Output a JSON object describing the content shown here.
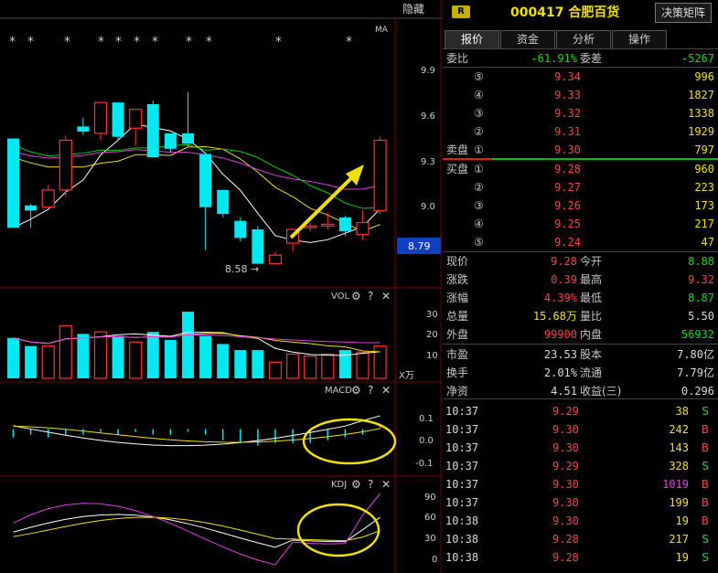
{
  "topbar": {
    "hide_label": "隐藏",
    "ma_label": "MA"
  },
  "price_axis": [
    "9.9",
    "9.6",
    "9.3",
    "9.0",
    "8.79"
  ],
  "low_marker": "8.58",
  "vol_panel": {
    "label": "VOL",
    "axis": [
      "30",
      "20",
      "10"
    ],
    "unit": "X万"
  },
  "macd_panel": {
    "label": "MACD",
    "axis": [
      "0.1",
      "0.0",
      "-0.1"
    ]
  },
  "kdj_panel": {
    "label": "KDJ",
    "axis": [
      "90",
      "60",
      "30",
      "0"
    ]
  },
  "icons": {
    "gear": "gear-icon",
    "help": "help-icon",
    "close": "close-icon"
  },
  "colors": {
    "up": "#ff3030",
    "down": "#00e8f0",
    "ma5": "#ffffff",
    "ma10": "#f0e000",
    "ma20": "#e040e0",
    "ma60": "#00d000",
    "highlight": "#f0e000"
  },
  "chart_data": {
    "type": "candlestick",
    "candles": [
      {
        "o": 9.31,
        "c": 8.79,
        "h": 9.31,
        "l": 8.79
      },
      {
        "o": 8.92,
        "c": 8.89,
        "h": 8.93,
        "l": 8.79
      },
      {
        "o": 8.91,
        "c": 9.01,
        "h": 9.04,
        "l": 8.91
      },
      {
        "o": 9.01,
        "c": 9.3,
        "h": 9.33,
        "l": 8.97
      },
      {
        "o": 9.38,
        "c": 9.35,
        "h": 9.43,
        "l": 9.33
      },
      {
        "o": 9.34,
        "c": 9.52,
        "h": 9.52,
        "l": 9.3
      },
      {
        "o": 9.52,
        "c": 9.32,
        "h": 9.52,
        "l": 9.3
      },
      {
        "o": 9.37,
        "c": 9.48,
        "h": 9.48,
        "l": 9.27
      },
      {
        "o": 9.51,
        "c": 9.2,
        "h": 9.53,
        "l": 9.2
      },
      {
        "o": 9.34,
        "c": 9.25,
        "h": 9.34,
        "l": 9.23
      },
      {
        "o": 9.34,
        "c": 9.28,
        "h": 9.58,
        "l": 9.26
      },
      {
        "o": 9.22,
        "c": 8.91,
        "h": 9.22,
        "l": 8.66
      },
      {
        "o": 9.01,
        "c": 8.87,
        "h": 9.01,
        "l": 8.85
      },
      {
        "o": 8.83,
        "c": 8.73,
        "h": 8.85,
        "l": 8.71
      },
      {
        "o": 8.78,
        "c": 8.58,
        "h": 8.8,
        "l": 8.58
      },
      {
        "o": 8.58,
        "c": 8.63,
        "h": 8.65,
        "l": 8.58
      },
      {
        "o": 8.7,
        "c": 8.78,
        "h": 8.78,
        "l": 8.65
      },
      {
        "o": 8.79,
        "c": 8.8,
        "h": 8.82,
        "l": 8.77
      },
      {
        "o": 8.8,
        "c": 8.81,
        "h": 8.88,
        "l": 8.78
      },
      {
        "o": 8.85,
        "c": 8.77,
        "h": 8.86,
        "l": 8.74
      },
      {
        "o": 8.75,
        "c": 8.82,
        "h": 8.89,
        "l": 8.72
      },
      {
        "o": 8.89,
        "c": 9.3,
        "h": 9.32,
        "l": 8.87
      }
    ],
    "volume": [
      20,
      16,
      16,
      26,
      22,
      23,
      21,
      18,
      23,
      19,
      33,
      21,
      17,
      14,
      14,
      8,
      12,
      11,
      12,
      14,
      13,
      16
    ],
    "macd_hist": [
      -0.03,
      -0.02,
      -0.03,
      -0.02,
      -0.02,
      -0.01,
      -0.02,
      -0.01,
      -0.02,
      -0.02,
      -0.01,
      -0.02,
      -0.04,
      -0.05,
      -0.06,
      -0.05,
      -0.05,
      -0.05,
      -0.04,
      -0.03,
      -0.02,
      0.02
    ],
    "y_range": [
      8.45,
      10.0
    ],
    "vol_range": [
      0,
      38
    ],
    "macd_range": [
      -0.16,
      0.16
    ],
    "kdj_range": [
      -5,
      105
    ]
  },
  "quote": {
    "code": "000417",
    "name": "合肥百货",
    "decide_button": "决策矩阵",
    "tabs": [
      "报价",
      "资金",
      "分析",
      "操作"
    ],
    "weibi_label": "委比",
    "weibi": "-61.91%",
    "weicha_label": "委差",
    "weicha": "-5267",
    "sell_label": "卖盘",
    "buy_label": "买盘",
    "sell": [
      {
        "lvl": "⑤",
        "price": "9.34",
        "vol": "996"
      },
      {
        "lvl": "④",
        "price": "9.33",
        "vol": "1827"
      },
      {
        "lvl": "③",
        "price": "9.32",
        "vol": "1338"
      },
      {
        "lvl": "②",
        "price": "9.31",
        "vol": "1929"
      },
      {
        "lvl": "①",
        "price": "9.30",
        "vol": "797"
      }
    ],
    "buy": [
      {
        "lvl": "①",
        "price": "9.28",
        "vol": "960"
      },
      {
        "lvl": "②",
        "price": "9.27",
        "vol": "223"
      },
      {
        "lvl": "③",
        "price": "9.26",
        "vol": "173"
      },
      {
        "lvl": "④",
        "price": "9.25",
        "vol": "217"
      },
      {
        "lvl": "⑤",
        "price": "9.24",
        "vol": "47"
      }
    ],
    "stats": [
      {
        "k1": "现价",
        "v1": "9.28",
        "c1": "red",
        "k2": "今开",
        "v2": "8.88",
        "c2": "green"
      },
      {
        "k1": "涨跌",
        "v1": "0.39",
        "c1": "red",
        "k2": "最高",
        "v2": "9.32",
        "c2": "red"
      },
      {
        "k1": "涨幅",
        "v1": "4.39%",
        "c1": "red",
        "k2": "最低",
        "v2": "8.87",
        "c2": "green"
      },
      {
        "k1": "总量",
        "v1": "15.68万",
        "c1": "yellow",
        "k2": "量比",
        "v2": "5.50",
        "c2": "white"
      },
      {
        "k1": "外盘",
        "v1": "99900",
        "c1": "red",
        "k2": "内盘",
        "v2": "56932",
        "c2": "green"
      },
      {
        "k1": "市盈",
        "v1": "23.53",
        "c1": "white",
        "k2": "股本",
        "v2": "7.80亿",
        "c2": "white"
      },
      {
        "k1": "换手",
        "v1": "2.01%",
        "c1": "white",
        "k2": "流通",
        "v2": "7.79亿",
        "c2": "white"
      },
      {
        "k1": "净资",
        "v1": "4.51",
        "c1": "white",
        "k2": "收益(三)",
        "v2": "0.296",
        "c2": "white"
      }
    ],
    "trades": [
      {
        "t": "10:37",
        "p": "9.29",
        "v": "38",
        "s": "S"
      },
      {
        "t": "10:37",
        "p": "9.30",
        "v": "242",
        "s": "B"
      },
      {
        "t": "10:37",
        "p": "9.30",
        "v": "143",
        "s": "B"
      },
      {
        "t": "10:37",
        "p": "9.29",
        "v": "328",
        "s": "S"
      },
      {
        "t": "10:37",
        "p": "9.30",
        "v": "1019",
        "s": "B"
      },
      {
        "t": "10:37",
        "p": "9.30",
        "v": "199",
        "s": "B"
      },
      {
        "t": "10:38",
        "p": "9.30",
        "v": "19",
        "s": "B"
      },
      {
        "t": "10:38",
        "p": "9.28",
        "v": "217",
        "s": "S"
      },
      {
        "t": "10:38",
        "p": "9.28",
        "v": "19",
        "s": "S"
      }
    ]
  }
}
